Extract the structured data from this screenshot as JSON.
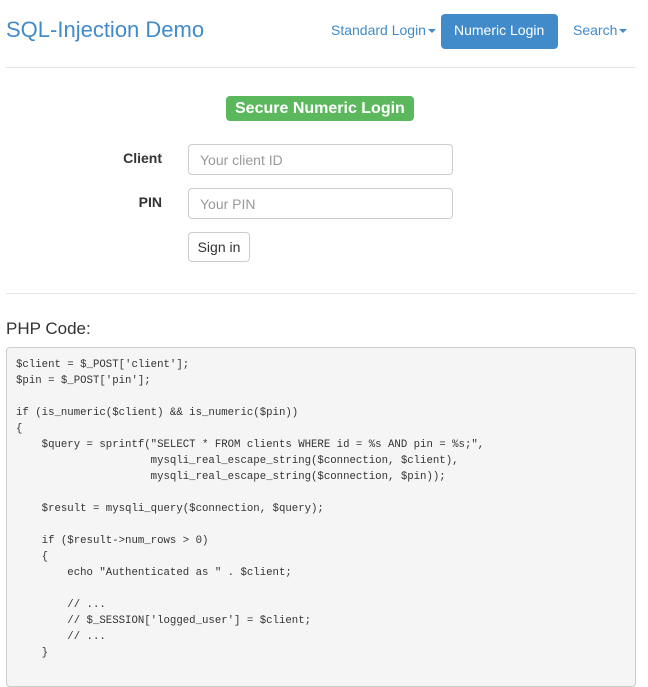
{
  "nav": {
    "brand": "SQL-Injection Demo",
    "items": [
      {
        "label": "Standard Login",
        "active": false
      },
      {
        "label": "Numeric Login",
        "active": true
      },
      {
        "label": "Search",
        "active": false
      }
    ]
  },
  "form": {
    "title": "Secure Numeric Login",
    "client_label": "Client",
    "client_placeholder": "Your client ID",
    "pin_label": "PIN",
    "pin_placeholder": "Your PIN",
    "submit": "Sign in"
  },
  "code": {
    "heading": "PHP Code:",
    "lines": [
      "$client = $_POST['client'];",
      "$pin = $_POST['pin'];",
      "",
      "if (is_numeric($client) && is_numeric($pin))",
      "{",
      "    $query = sprintf(\"SELECT * FROM clients WHERE id = %s AND pin = %s;\",",
      "                     mysqli_real_escape_string($connection, $client),",
      "                     mysqli_real_escape_string($connection, $pin));",
      "",
      "    $result = mysqli_query($connection, $query);",
      "",
      "    if ($result->num_rows > 0)",
      "    {",
      "        echo \"Authenticated as \" . $client;",
      "",
      "        // ...",
      "        // $_SESSION['logged_user'] = $client;",
      "        // ...",
      "    }"
    ]
  },
  "colors": {
    "primary": "#428bca",
    "success": "#5cb85c"
  }
}
